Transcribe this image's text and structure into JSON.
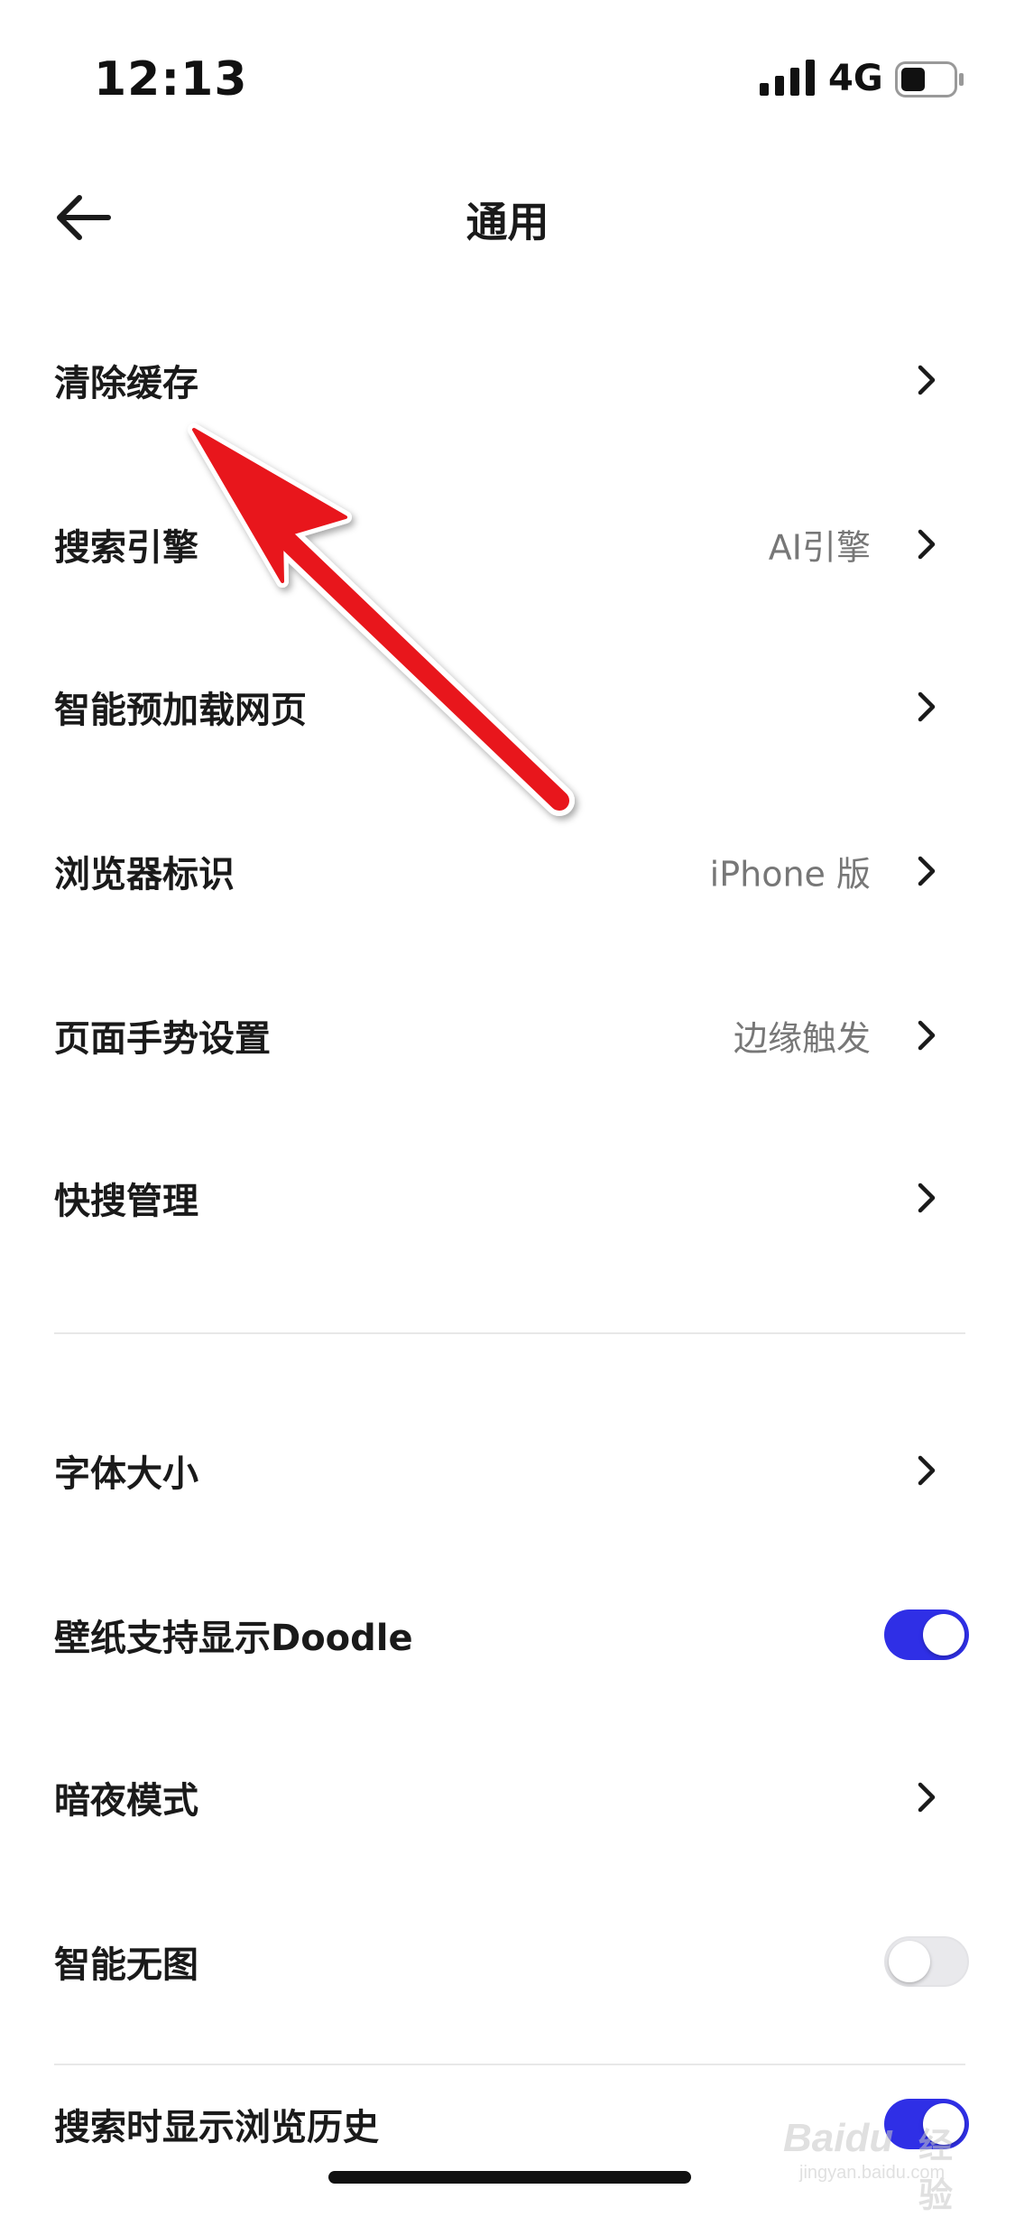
{
  "status_bar": {
    "time": "12:13",
    "network": "4G",
    "battery_level": 0.45
  },
  "header": {
    "title": "通用",
    "back_icon": "arrow-left-icon"
  },
  "settings": {
    "clear_cache": {
      "label": "清除缓存"
    },
    "search_engine": {
      "label": "搜索引擎",
      "value": "AI引擎"
    },
    "preload": {
      "label": "智能预加载网页"
    },
    "user_agent": {
      "label": "浏览器标识",
      "value": "iPhone 版"
    },
    "gesture": {
      "label": "页面手势设置",
      "value": "边缘触发"
    },
    "quick_search": {
      "label": "快搜管理"
    },
    "font_size": {
      "label": "字体大小"
    },
    "doodle": {
      "label": "壁纸支持显示Doodle",
      "enabled": true
    },
    "dark_mode": {
      "label": "暗夜模式"
    },
    "no_image": {
      "label": "智能无图",
      "enabled": false
    },
    "search_history": {
      "label": "搜索时显示浏览历史",
      "enabled": true
    }
  },
  "colors": {
    "toggle_on": "#2f2fe6",
    "annotation_arrow": "#e8141c"
  },
  "watermark": {
    "brand": "Baidu",
    "brand_cn": "经验",
    "domain": "jingyan.baidu.com"
  }
}
